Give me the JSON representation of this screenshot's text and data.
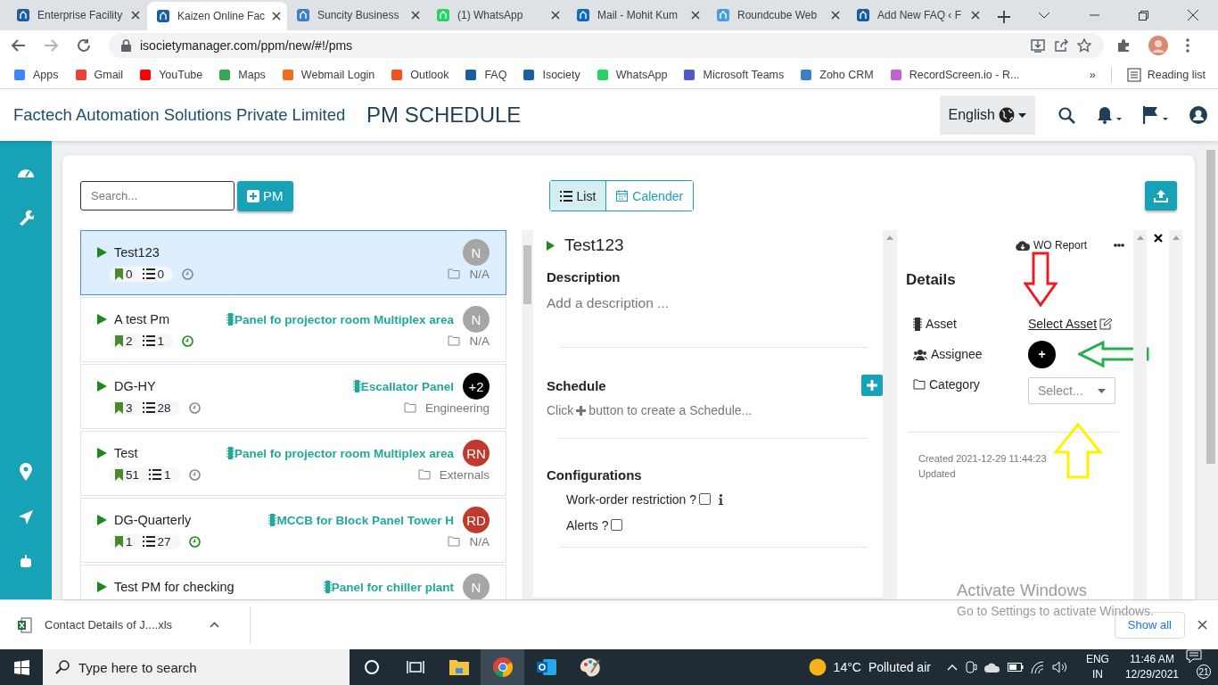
{
  "browser": {
    "tabs": [
      {
        "title": "Enterprise Facility",
        "selected": false,
        "color": "#1a5fa0"
      },
      {
        "title": "Kaizen Online Fac",
        "selected": true,
        "color": "#1a5fa0"
      },
      {
        "title": "Suncity Business",
        "selected": false,
        "color": "#3b7fc4"
      },
      {
        "title": "(1) WhatsApp",
        "selected": false,
        "color": "#25d366"
      },
      {
        "title": "Mail - Mohit Kum",
        "selected": false,
        "color": "#0f6cbd"
      },
      {
        "title": "Roundcube Web",
        "selected": false,
        "color": "#4a9fd8"
      },
      {
        "title": "Add New FAQ ‹ F",
        "selected": false,
        "color": "#1b5e9e"
      }
    ],
    "address": "isocietymanager.com/ppm/new/#!/pms",
    "bookmarks": [
      {
        "label": "Apps",
        "color": "#4285f4"
      },
      {
        "label": "Gmail",
        "color": "#ea4335"
      },
      {
        "label": "YouTube",
        "color": "#ff0000"
      },
      {
        "label": "Maps",
        "color": "#34a853"
      },
      {
        "label": "Webmail Login",
        "color": "#f26b21"
      },
      {
        "label": "Outlook",
        "color": "#f25022"
      },
      {
        "label": "FAQ",
        "color": "#1b5e9e"
      },
      {
        "label": "Isociety",
        "color": "#1a5fa0"
      },
      {
        "label": "WhatsApp",
        "color": "#25d366"
      },
      {
        "label": "Microsoft Teams",
        "color": "#5059c9"
      },
      {
        "label": "Zoho CRM",
        "color": "#3b7fc4"
      },
      {
        "label": "RecordScreen.io - R...",
        "color": "#c55fd6"
      }
    ],
    "more": "»",
    "reading_list": "Reading list"
  },
  "header": {
    "company": "Factech Automation Solutions Private Limited",
    "title": "PM SCHEDULE",
    "language": "English"
  },
  "toolbar": {
    "search_placeholder": "Search...",
    "add_button": "PM",
    "views": [
      {
        "label": "List",
        "selected": true
      },
      {
        "label": "Calender",
        "selected": false
      }
    ]
  },
  "list": {
    "items": [
      {
        "title": "Test123",
        "avatar": "N",
        "color": "#a6a6a6",
        "category": "N/A",
        "bookmarks": "0",
        "tasks": "0",
        "scheduled": false,
        "selected": true
      },
      {
        "title": "A test Pm",
        "asset": "Panel fo projector room Multiplex area",
        "avatar": "N",
        "color": "#a6a6a6",
        "category": "N/A",
        "bookmarks": "2",
        "tasks": "1",
        "scheduled": true,
        "selected": false
      },
      {
        "title": "DG-HY",
        "asset": "Escallator Panel",
        "avatar": "+2",
        "color": "#000000",
        "category": "Engineering",
        "bookmarks": "3",
        "tasks": "28",
        "scheduled": false,
        "selected": false
      },
      {
        "title": "Test",
        "asset": "Panel fo projector room Multiplex area",
        "avatar": "RN",
        "color": "#c0392b",
        "category": "Externals",
        "bookmarks": "51",
        "tasks": "1",
        "scheduled": false,
        "selected": false
      },
      {
        "title": "DG-Quarterly",
        "asset": "MCCB for Block Panel Tower H",
        "avatar": "RD",
        "color": "#c0392b",
        "category": "N/A",
        "bookmarks": "1",
        "tasks": "27",
        "scheduled": true,
        "selected": false
      },
      {
        "title": "Test PM for checking",
        "asset": "Panel for chiller plant",
        "avatar": "N",
        "color": "#a6a6a6",
        "selected": false
      }
    ]
  },
  "detail": {
    "title": "Test123",
    "description": {
      "heading": "Description",
      "placeholder": "Add a description ..."
    },
    "schedule": {
      "heading": "Schedule",
      "hint_before": "Click",
      "hint_after": "button to create a Schedule..."
    },
    "configurations": {
      "heading": "Configurations",
      "options": [
        {
          "label": "Work-order restriction ?",
          "checked": false,
          "info": true
        },
        {
          "label": "Alerts ?",
          "checked": false,
          "info": false
        }
      ]
    }
  },
  "details_panel": {
    "report": "WO Report",
    "heading": "Details",
    "fields": [
      {
        "kind": "link",
        "label": "Asset",
        "value": "Select Asset"
      },
      {
        "kind": "add",
        "label": "Assignee",
        "value": "+"
      },
      {
        "kind": "select",
        "label": "Category",
        "placeholder": "Select..."
      }
    ],
    "created": "Created 2021-12-29 11:44:23",
    "updated": "Updated"
  },
  "annotations": [
    {
      "kind": "down",
      "color": "#ed1c24"
    },
    {
      "kind": "left",
      "color": "#22b14c"
    },
    {
      "kind": "up",
      "color": "#fff200"
    }
  ],
  "downloads": {
    "file": "Contact Details of J....xls",
    "show_all": "Show all"
  },
  "activation": {
    "title": "Activate Windows",
    "hint": "Go to Settings to activate Windows."
  },
  "taskbar": {
    "search_placeholder": "Type here to search",
    "apps": [
      {
        "kind": "cortana",
        "selected": false
      },
      {
        "kind": "taskview",
        "selected": false
      },
      {
        "kind": "explorer",
        "selected": false
      },
      {
        "kind": "chrome",
        "selected": true
      },
      {
        "kind": "outlook",
        "selected": false
      },
      {
        "kind": "paint",
        "selected": false
      }
    ],
    "weather": {
      "temperature": "14°C",
      "condition": "Polluted air"
    },
    "language": [
      "ENG",
      "IN"
    ],
    "time": "11:46 AM",
    "date": "12/29/2021",
    "notifications": "21"
  }
}
